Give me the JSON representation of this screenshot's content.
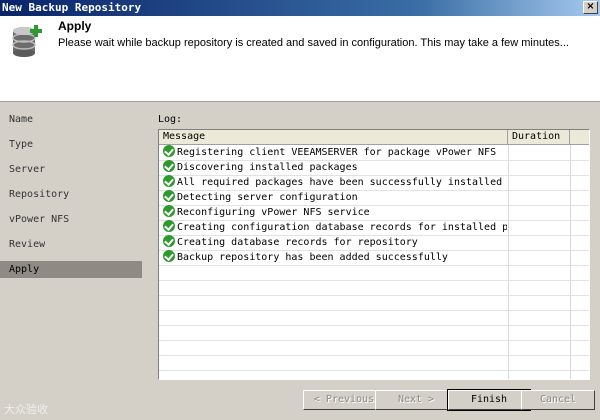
{
  "window": {
    "title": "New Backup Repository",
    "close_glyph": "×"
  },
  "header": {
    "title": "Apply",
    "description": "Please wait while backup repository is created and saved in configuration. This may take a few minutes...",
    "icon": "database-add-icon"
  },
  "steps": [
    {
      "label": "Name",
      "active": false
    },
    {
      "label": "Type",
      "active": false
    },
    {
      "label": "Server",
      "active": false
    },
    {
      "label": "Repository",
      "active": false
    },
    {
      "label": "vPower NFS",
      "active": false
    },
    {
      "label": "Review",
      "active": false
    },
    {
      "label": "Apply",
      "active": true
    }
  ],
  "log": {
    "label": "Log:",
    "columns": {
      "message": "Message",
      "duration": "Duration"
    },
    "rows": [
      {
        "status": "success",
        "message": "Registering client VEEAMSERVER for package vPower NFS",
        "duration": ""
      },
      {
        "status": "success",
        "message": "Discovering installed packages",
        "duration": ""
      },
      {
        "status": "success",
        "message": "All required packages have been successfully installed",
        "duration": ""
      },
      {
        "status": "success",
        "message": "Detecting server configuration",
        "duration": ""
      },
      {
        "status": "success",
        "message": "Reconfiguring vPower NFS service",
        "duration": ""
      },
      {
        "status": "success",
        "message": "Creating configuration database records for installed pack...",
        "duration": ""
      },
      {
        "status": "success",
        "message": "Creating database records for repository",
        "duration": ""
      },
      {
        "status": "success",
        "message": "Backup repository has been added successfully",
        "duration": ""
      }
    ]
  },
  "buttons": {
    "previous": "< Previous",
    "next": "Next >",
    "finish": "Finish",
    "cancel": "Cancel"
  },
  "watermark": "大众验收",
  "colors": {
    "success": "#2e9a2e",
    "active_step": "#8f8b84"
  }
}
